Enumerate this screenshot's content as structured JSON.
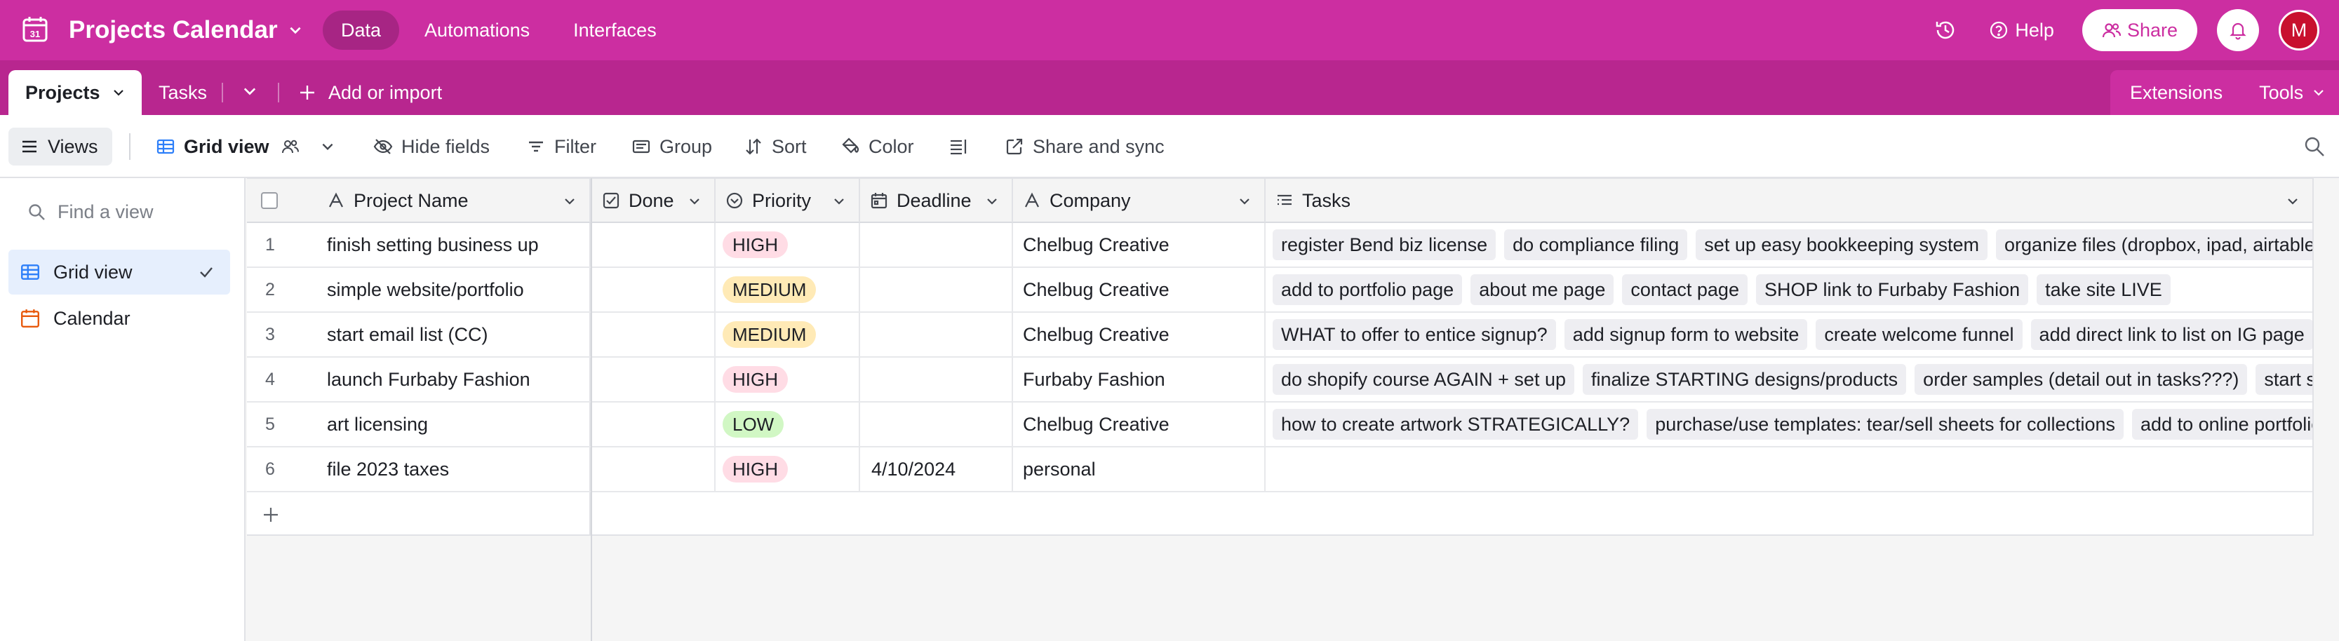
{
  "app": {
    "title": "Projects Calendar",
    "accent": "#cc2ea1",
    "nav": [
      {
        "label": "Data",
        "active": true
      },
      {
        "label": "Automations",
        "active": false
      },
      {
        "label": "Interfaces",
        "active": false
      }
    ],
    "help_label": "Help",
    "share_label": "Share",
    "avatar_initial": "M"
  },
  "tables": {
    "items": [
      {
        "label": "Projects",
        "active": true
      },
      {
        "label": "Tasks",
        "active": false
      }
    ],
    "add_import_label": "Add or import",
    "extensions_label": "Extensions",
    "tools_label": "Tools"
  },
  "toolbar": {
    "views_label": "Views",
    "view_name": "Grid view",
    "hide_fields": "Hide fields",
    "filter": "Filter",
    "group": "Group",
    "sort": "Sort",
    "color": "Color",
    "share_sync": "Share and sync"
  },
  "sidebar": {
    "find_placeholder": "Find a view",
    "views": [
      {
        "label": "Grid view",
        "active": true
      },
      {
        "label": "Calendar",
        "active": false
      }
    ]
  },
  "grid": {
    "columns": {
      "name": "Project Name",
      "done": "Done",
      "priority": "Priority",
      "deadline": "Deadline",
      "company": "Company",
      "tasks": "Tasks"
    },
    "priority_colors": {
      "HIGH": "#ffdce5",
      "MEDIUM": "#ffeab6",
      "LOW": "#d1f7c4"
    },
    "rows": [
      {
        "num": "1",
        "name": "finish setting business up",
        "priority": "HIGH",
        "deadline": "",
        "company": "Chelbug Creative",
        "tasks": [
          "register Bend biz license",
          "do compliance filing",
          "set up easy bookkeeping system",
          "organize files (dropbox, ipad, airtable,"
        ]
      },
      {
        "num": "2",
        "name": "simple website/portfolio",
        "priority": "MEDIUM",
        "deadline": "",
        "company": "Chelbug Creative",
        "tasks": [
          "add to portfolio page",
          "about me page",
          "contact page",
          "SHOP link to Furbaby Fashion",
          "take site LIVE"
        ]
      },
      {
        "num": "3",
        "name": "start email list (CC)",
        "priority": "MEDIUM",
        "deadline": "",
        "company": "Chelbug Creative",
        "tasks": [
          "WHAT to offer to entice signup?",
          "add signup form to website",
          "create welcome funnel",
          "add direct link to list on IG page"
        ]
      },
      {
        "num": "4",
        "name": "launch Furbaby Fashion",
        "priority": "HIGH",
        "deadline": "",
        "company": "Furbaby Fashion",
        "tasks": [
          "do shopify course AGAIN + set up",
          "finalize STARTING designs/products",
          "order samples (detail out in tasks???)",
          "start sha"
        ]
      },
      {
        "num": "5",
        "name": "art licensing",
        "priority": "LOW",
        "deadline": "",
        "company": "Chelbug Creative",
        "tasks": [
          "how to create artwork STRATEGICALLY?",
          "purchase/use templates: tear/sell sheets for collections",
          "add to online portfolio"
        ]
      },
      {
        "num": "6",
        "name": "file 2023 taxes",
        "priority": "HIGH",
        "deadline": "4/10/2024",
        "company": "personal",
        "tasks": []
      }
    ]
  }
}
